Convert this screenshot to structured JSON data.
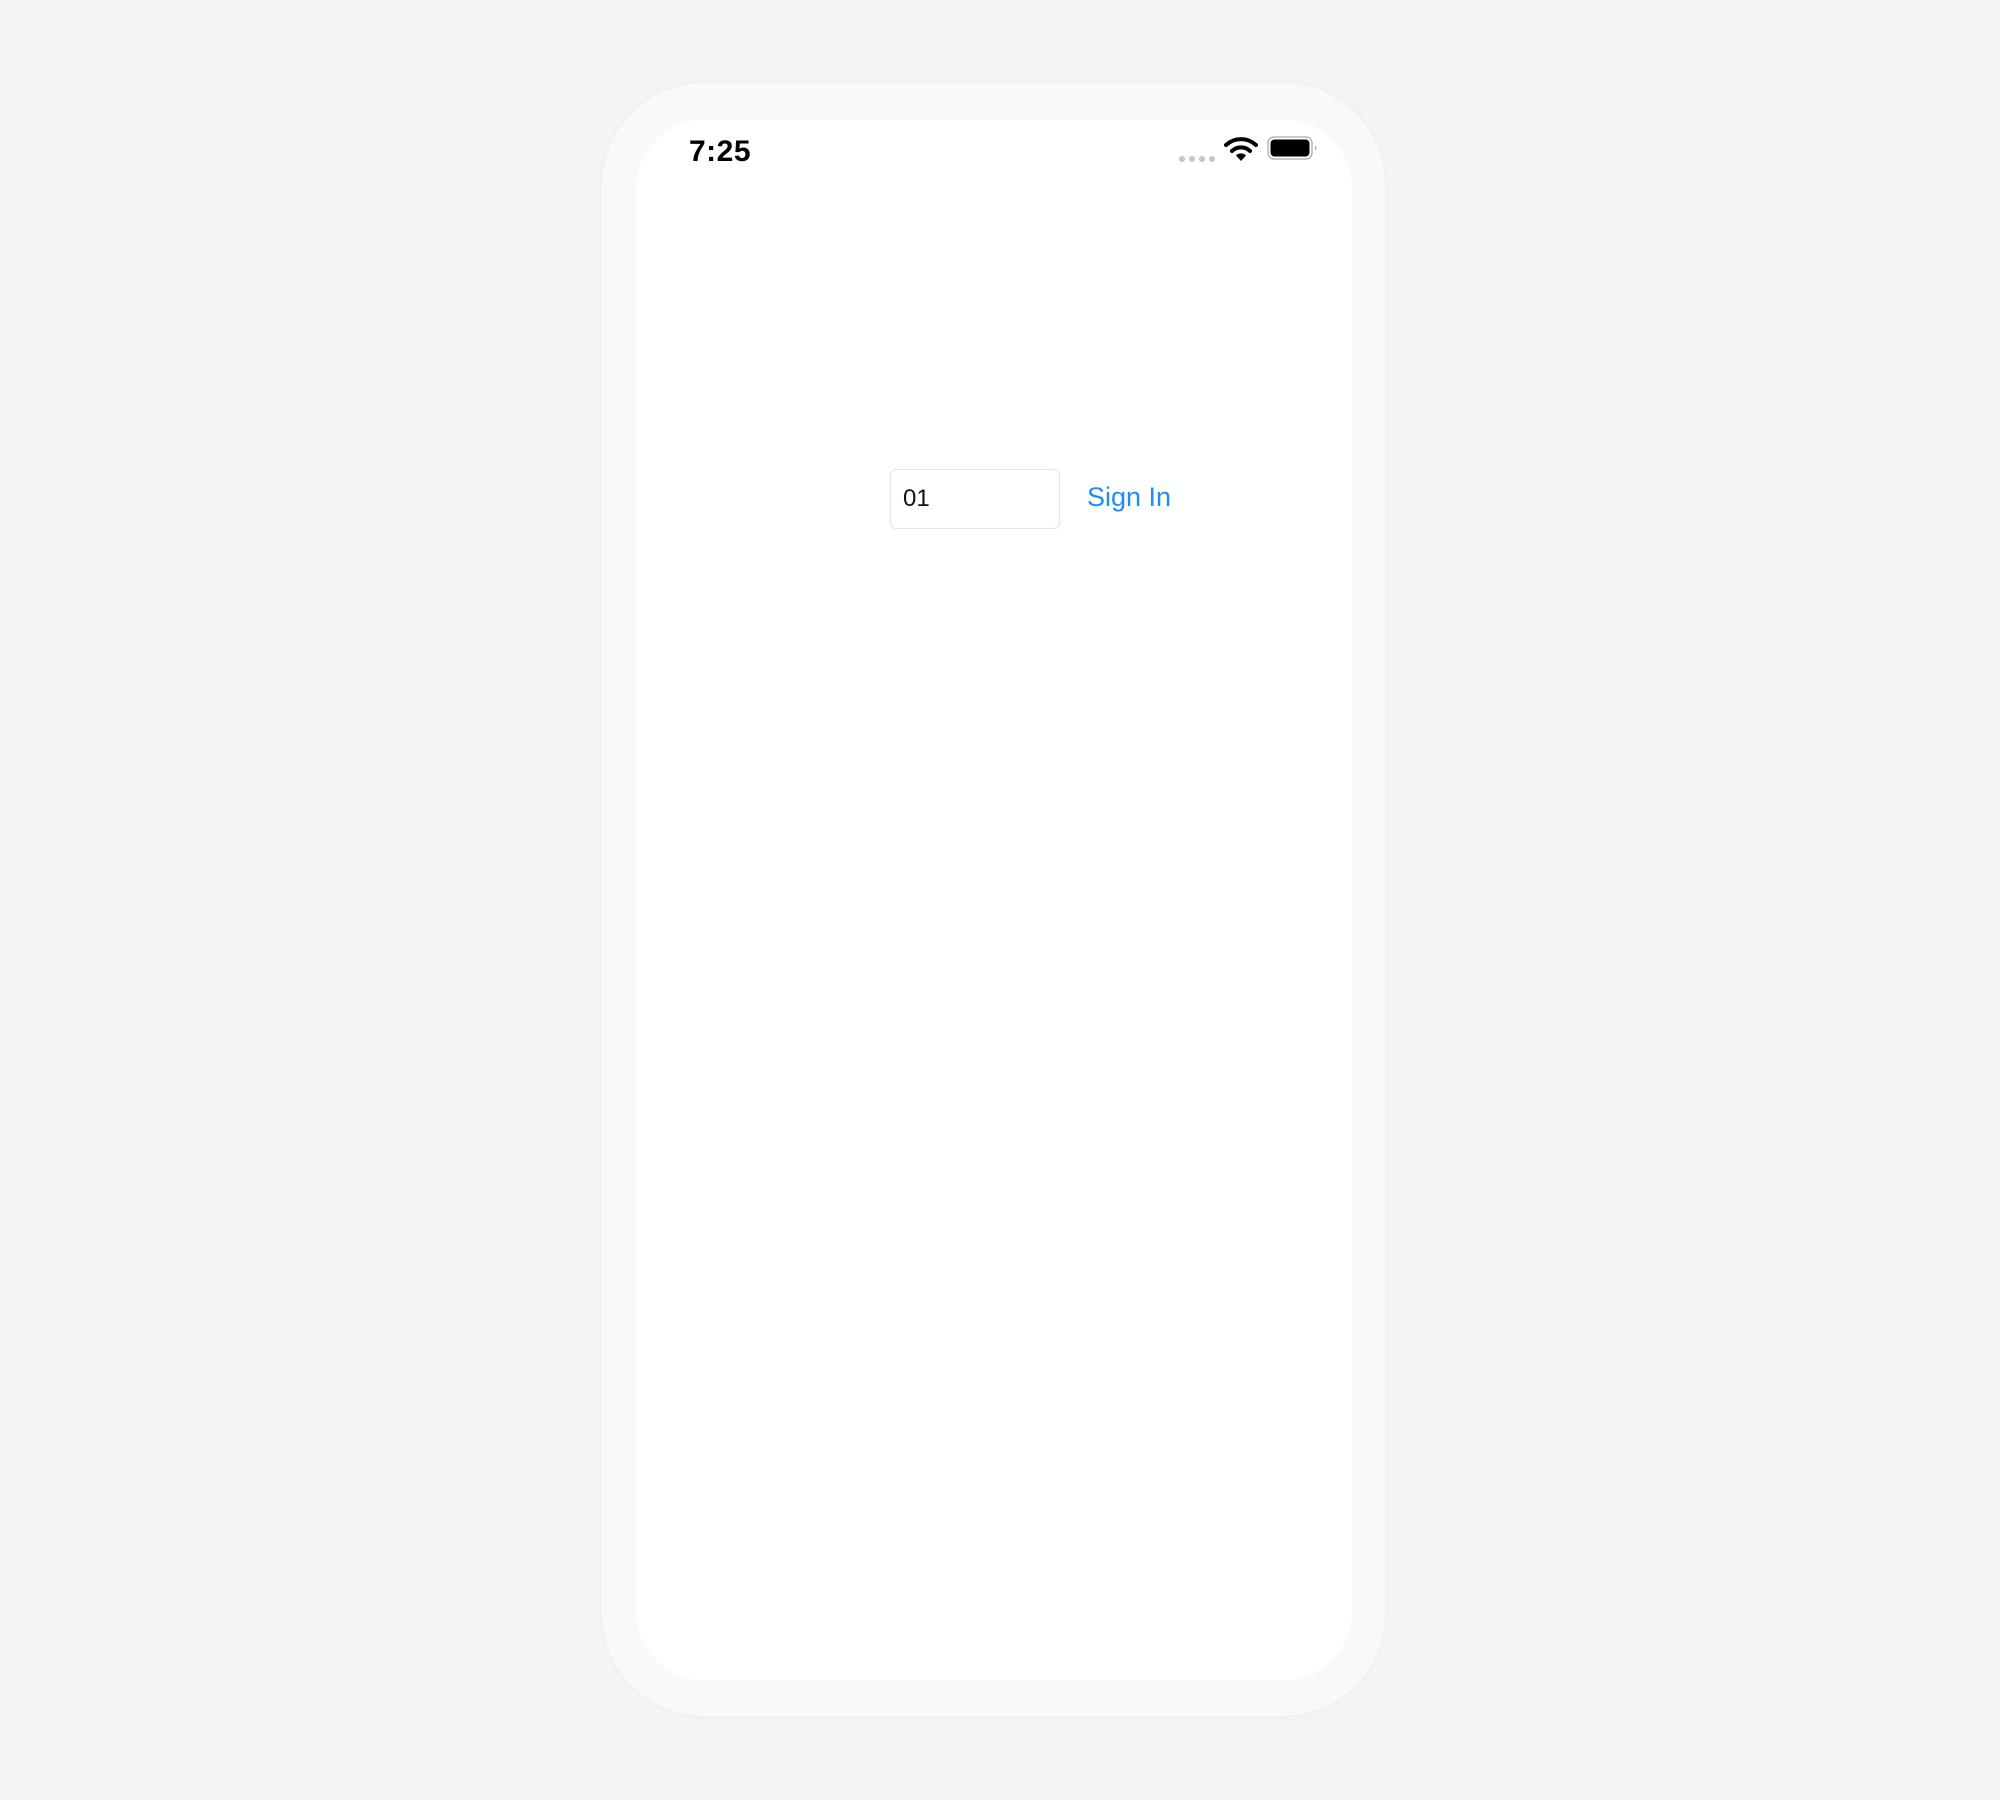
{
  "status_bar": {
    "time": "7:25",
    "signal_icon": "cellular-signal-icon",
    "wifi_icon": "wifi-icon",
    "battery_icon": "battery-icon"
  },
  "login": {
    "code_value": "01",
    "sign_in_label": "Sign In"
  },
  "colors": {
    "accent": "#1a8cff",
    "page_background": "#f4f4f4",
    "device_frame": "#f9f9f9",
    "screen_background": "#ffffff",
    "input_border": "#e3e3e3"
  }
}
